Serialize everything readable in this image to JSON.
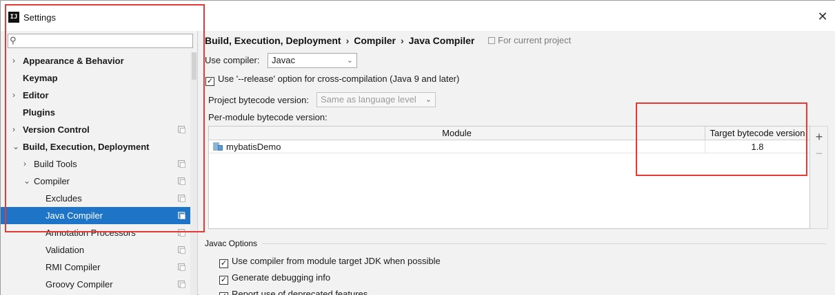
{
  "window": {
    "title": "Settings",
    "close_label": "✕",
    "logo_text": "IJ"
  },
  "sidebar": {
    "search_placeholder": "",
    "search_icon": "search-icon",
    "items": [
      {
        "label": "Appearance & Behavior",
        "level": 0,
        "arrow": "›",
        "bold": true,
        "project_icon": false,
        "selected": false
      },
      {
        "label": "Keymap",
        "level": 0,
        "arrow": "",
        "bold": true,
        "project_icon": false,
        "selected": false
      },
      {
        "label": "Editor",
        "level": 0,
        "arrow": "›",
        "bold": true,
        "project_icon": false,
        "selected": false
      },
      {
        "label": "Plugins",
        "level": 0,
        "arrow": "",
        "bold": true,
        "project_icon": false,
        "selected": false
      },
      {
        "label": "Version Control",
        "level": 0,
        "arrow": "›",
        "bold": true,
        "project_icon": true,
        "selected": false
      },
      {
        "label": "Build, Execution, Deployment",
        "level": 0,
        "arrow": "⌄",
        "bold": true,
        "project_icon": false,
        "selected": false
      },
      {
        "label": "Build Tools",
        "level": 1,
        "arrow": "›",
        "bold": false,
        "project_icon": true,
        "selected": false
      },
      {
        "label": "Compiler",
        "level": 1,
        "arrow": "⌄",
        "bold": false,
        "project_icon": true,
        "selected": false
      },
      {
        "label": "Excludes",
        "level": 2,
        "arrow": "",
        "bold": false,
        "project_icon": true,
        "selected": false
      },
      {
        "label": "Java Compiler",
        "level": 2,
        "arrow": "",
        "bold": false,
        "project_icon": true,
        "selected": true
      },
      {
        "label": "Annotation Processors",
        "level": 2,
        "arrow": "",
        "bold": false,
        "project_icon": true,
        "selected": false
      },
      {
        "label": "Validation",
        "level": 2,
        "arrow": "",
        "bold": false,
        "project_icon": true,
        "selected": false
      },
      {
        "label": "RMI Compiler",
        "level": 2,
        "arrow": "",
        "bold": false,
        "project_icon": true,
        "selected": false
      },
      {
        "label": "Groovy Compiler",
        "level": 2,
        "arrow": "",
        "bold": false,
        "project_icon": true,
        "selected": false
      }
    ]
  },
  "breadcrumb": {
    "parts": [
      "Build, Execution, Deployment",
      "Compiler",
      "Java Compiler"
    ],
    "separator": "›",
    "scope_label": "For current project"
  },
  "compiler": {
    "use_compiler_label": "Use compiler:",
    "use_compiler_value": "Javac",
    "release_option_checked": true,
    "release_option_label": "Use '--release' option for cross-compilation (Java 9 and later)",
    "project_bytecode_label": "Project bytecode version:",
    "project_bytecode_value": "Same as language level",
    "per_module_label": "Per-module bytecode version:"
  },
  "module_table": {
    "headers": [
      "Module",
      "Target bytecode version"
    ],
    "rows": [
      {
        "module": "mybatisDemo",
        "target": "1.8"
      }
    ],
    "add_label": "+",
    "remove_label": "−"
  },
  "javac_options": {
    "title": "Javac Options",
    "options": [
      {
        "label": "Use compiler from module target JDK when possible",
        "checked": true
      },
      {
        "label": "Generate debugging info",
        "checked": true
      },
      {
        "label": "Report use of deprecated features",
        "checked": true
      }
    ]
  },
  "colors": {
    "selection": "#1e74c6",
    "annotation_red": "#e53935",
    "background": "#f2f2f2"
  }
}
